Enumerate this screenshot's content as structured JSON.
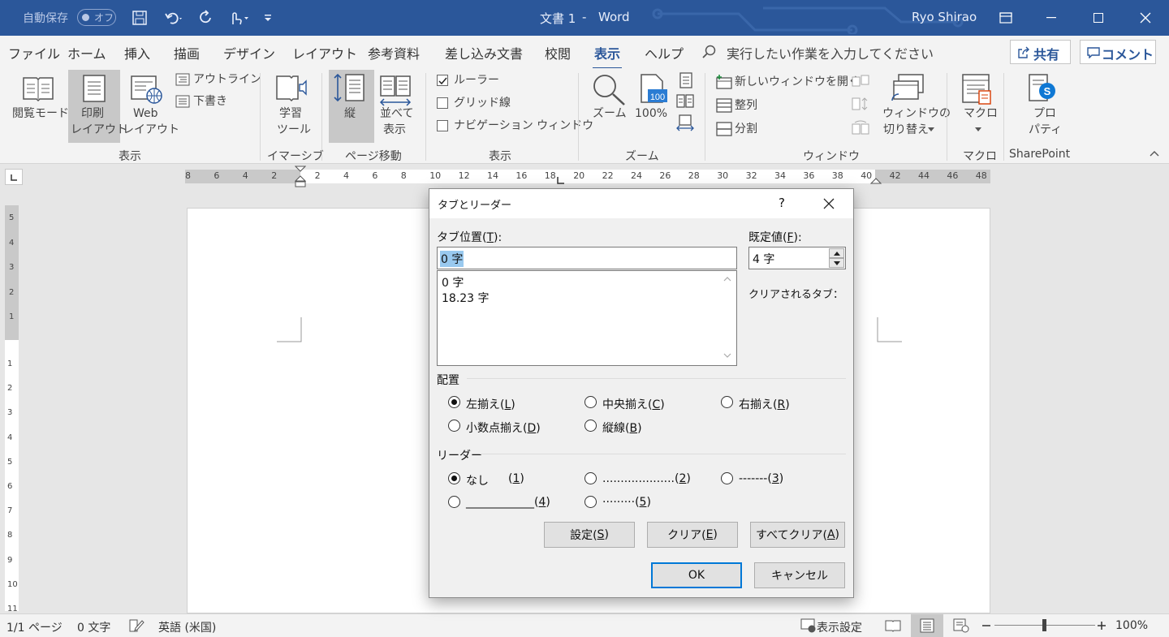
{
  "window": {
    "autosave_label": "自動保存",
    "autosave_state": "オフ",
    "doc_title": "文書 1",
    "title_sep": "-",
    "app_name": "Word",
    "user_name": "Ryo Shirao"
  },
  "tabs": [
    "ファイル",
    "ホーム",
    "挿入",
    "描画",
    "デザイン",
    "レイアウト",
    "参考資料",
    "差し込み文書",
    "校閲",
    "表示",
    "ヘルプ"
  ],
  "active_tab": "表示",
  "tellme": "実行したい作業を入力してください",
  "share_label": "共有",
  "comment_label": "コメント",
  "ribbon": {
    "views": {
      "read_mode": "閲覧モード",
      "print_layout_1": "印刷",
      "print_layout_2": "レイアウト",
      "web_layout_1": "Web",
      "web_layout_2": "レイアウト",
      "outline": "アウトライン",
      "draft": "下書き",
      "group": "表示"
    },
    "immersive": {
      "learning_tools_1": "学習",
      "learning_tools_2": "ツール",
      "group": "イマーシブ"
    },
    "page_movement": {
      "vertical": "縦",
      "side_by_side_1": "並べて",
      "side_by_side_2": "表示",
      "group": "ページ移動"
    },
    "show": {
      "ruler": "ルーラー",
      "gridlines": "グリッド線",
      "nav_pane": "ナビゲーション ウィンドウ",
      "group": "表示"
    },
    "zoom": {
      "zoom": "ズーム",
      "hundred": "100%",
      "group": "ズーム",
      "badge": "100"
    },
    "window": {
      "new_window": "新しいウィンドウを開く",
      "arrange": "整列",
      "split": "分割",
      "switch_1": "ウィンドウの",
      "switch_2": "切り替え",
      "group": "ウィンドウ"
    },
    "macros": {
      "label": "マクロ",
      "group": "マクロ"
    },
    "sharepoint": {
      "props_1": "プロ",
      "props_2": "パティ",
      "group": "SharePoint"
    }
  },
  "ruler_h": [
    "8",
    "6",
    "4",
    "2",
    "2",
    "4",
    "6",
    "8",
    "10",
    "12",
    "14",
    "16",
    "18",
    "20",
    "22",
    "24",
    "26",
    "28",
    "30",
    "32",
    "34",
    "36",
    "38",
    "40",
    "42",
    "44",
    "46",
    "48"
  ],
  "ruler_v_top": [
    "5",
    "4",
    "3",
    "2",
    "1"
  ],
  "ruler_v_bottom": [
    "1",
    "2",
    "3",
    "4",
    "5",
    "6",
    "7",
    "8",
    "9",
    "10",
    "11"
  ],
  "status": {
    "page": "1/1 ページ",
    "words": "0 文字",
    "lang": "英語 (米国)",
    "display": "表示設定",
    "zoom": "100%"
  },
  "dialog": {
    "title": "タブとリーダー",
    "help": "?",
    "tab_pos_label": "タブ位置(",
    "tab_pos_key": "T",
    "tab_pos_end": "):",
    "tab_pos_value": "0 字",
    "tab_list": [
      "0 字",
      "18.23 字"
    ],
    "default_label": "既定値(",
    "default_key": "F",
    "default_end": "):",
    "default_value": "4 字",
    "cleared_label": "クリアされるタブ：",
    "alignment_label": "配置",
    "align_left": "左揃え(",
    "align_left_key": "L",
    "align_center": "中央揃え(",
    "align_center_key": "C",
    "align_right": "右揃え(",
    "align_right_key": "R",
    "align_decimal": "小数点揃え(",
    "align_decimal_key": "D",
    "align_bar": "縦線(",
    "align_bar_key": "B",
    "leader_label": "リーダー",
    "leader_1": "なし",
    "leader_1_key": "1",
    "leader_2": "....................",
    "leader_2_key": "2",
    "leader_3": "-------",
    "leader_3_key": "3",
    "leader_4": "____________",
    "leader_4_key": "4",
    "leader_5": "·········",
    "leader_5_key": "5",
    "set_btn": "設定(",
    "set_key": "S",
    "clear_btn": "クリア(",
    "clear_key": "E",
    "clear_all_btn": "すべてクリア(",
    "clear_all_key": "A",
    "ok": "OK",
    "cancel": "キャンセル",
    "close_paren": ")"
  },
  "colors": {
    "brand": "#2b579a",
    "accent": "#0078d7"
  }
}
